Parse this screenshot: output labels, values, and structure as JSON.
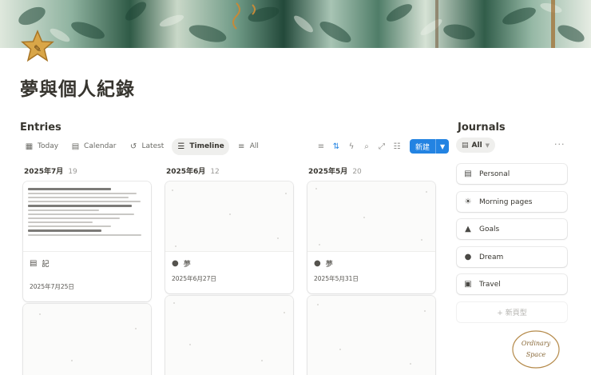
{
  "page": {
    "title": "夢與個人紀錄"
  },
  "entries": {
    "heading": "Entries",
    "views": [
      {
        "label": "Today",
        "icon": "calendar-today-icon"
      },
      {
        "label": "Calendar",
        "icon": "calendar-icon"
      },
      {
        "label": "Latest",
        "icon": "history-icon"
      },
      {
        "label": "Timeline",
        "icon": "timeline-icon"
      },
      {
        "label": "All",
        "icon": "list-edit-icon"
      }
    ],
    "active_view": "Timeline",
    "new_button": "新建",
    "columns": [
      {
        "month": "2025年7月",
        "count": "19",
        "cards": [
          {
            "title": "記",
            "icon": "document-icon",
            "date": "2025年7月25日",
            "preview": "document"
          },
          {
            "title": "",
            "icon": "",
            "date": "",
            "preview": "blank"
          }
        ]
      },
      {
        "month": "2025年6月",
        "count": "12",
        "cards": [
          {
            "title": "夢",
            "icon": "dream-bubble-icon",
            "date": "2025年6月27日",
            "preview": "blank"
          },
          {
            "title": "",
            "icon": "",
            "date": "",
            "preview": "blank"
          }
        ]
      },
      {
        "month": "2025年5月",
        "count": "20",
        "cards": [
          {
            "title": "夢",
            "icon": "dream-bubble-icon",
            "date": "2025年5月31日",
            "preview": "blank"
          },
          {
            "title": "",
            "icon": "",
            "date": "",
            "preview": "blank"
          }
        ]
      }
    ]
  },
  "journals": {
    "heading": "Journals",
    "filter": "All",
    "items": [
      {
        "label": "Personal",
        "icon": "document-icon"
      },
      {
        "label": "Morning pages",
        "icon": "sun-icon"
      },
      {
        "label": "Goals",
        "icon": "mountain-icon"
      },
      {
        "label": "Dream",
        "icon": "dream-bubble-icon"
      },
      {
        "label": "Travel",
        "icon": "ticket-icon"
      }
    ],
    "new_group": "+ 新頁型"
  },
  "logo": {
    "line1": "Ordinary",
    "line2": "Space"
  },
  "colors": {
    "accent": "#2383e2",
    "text": "#37352f",
    "muted": "#9b9a97",
    "star": "#c9963a"
  }
}
